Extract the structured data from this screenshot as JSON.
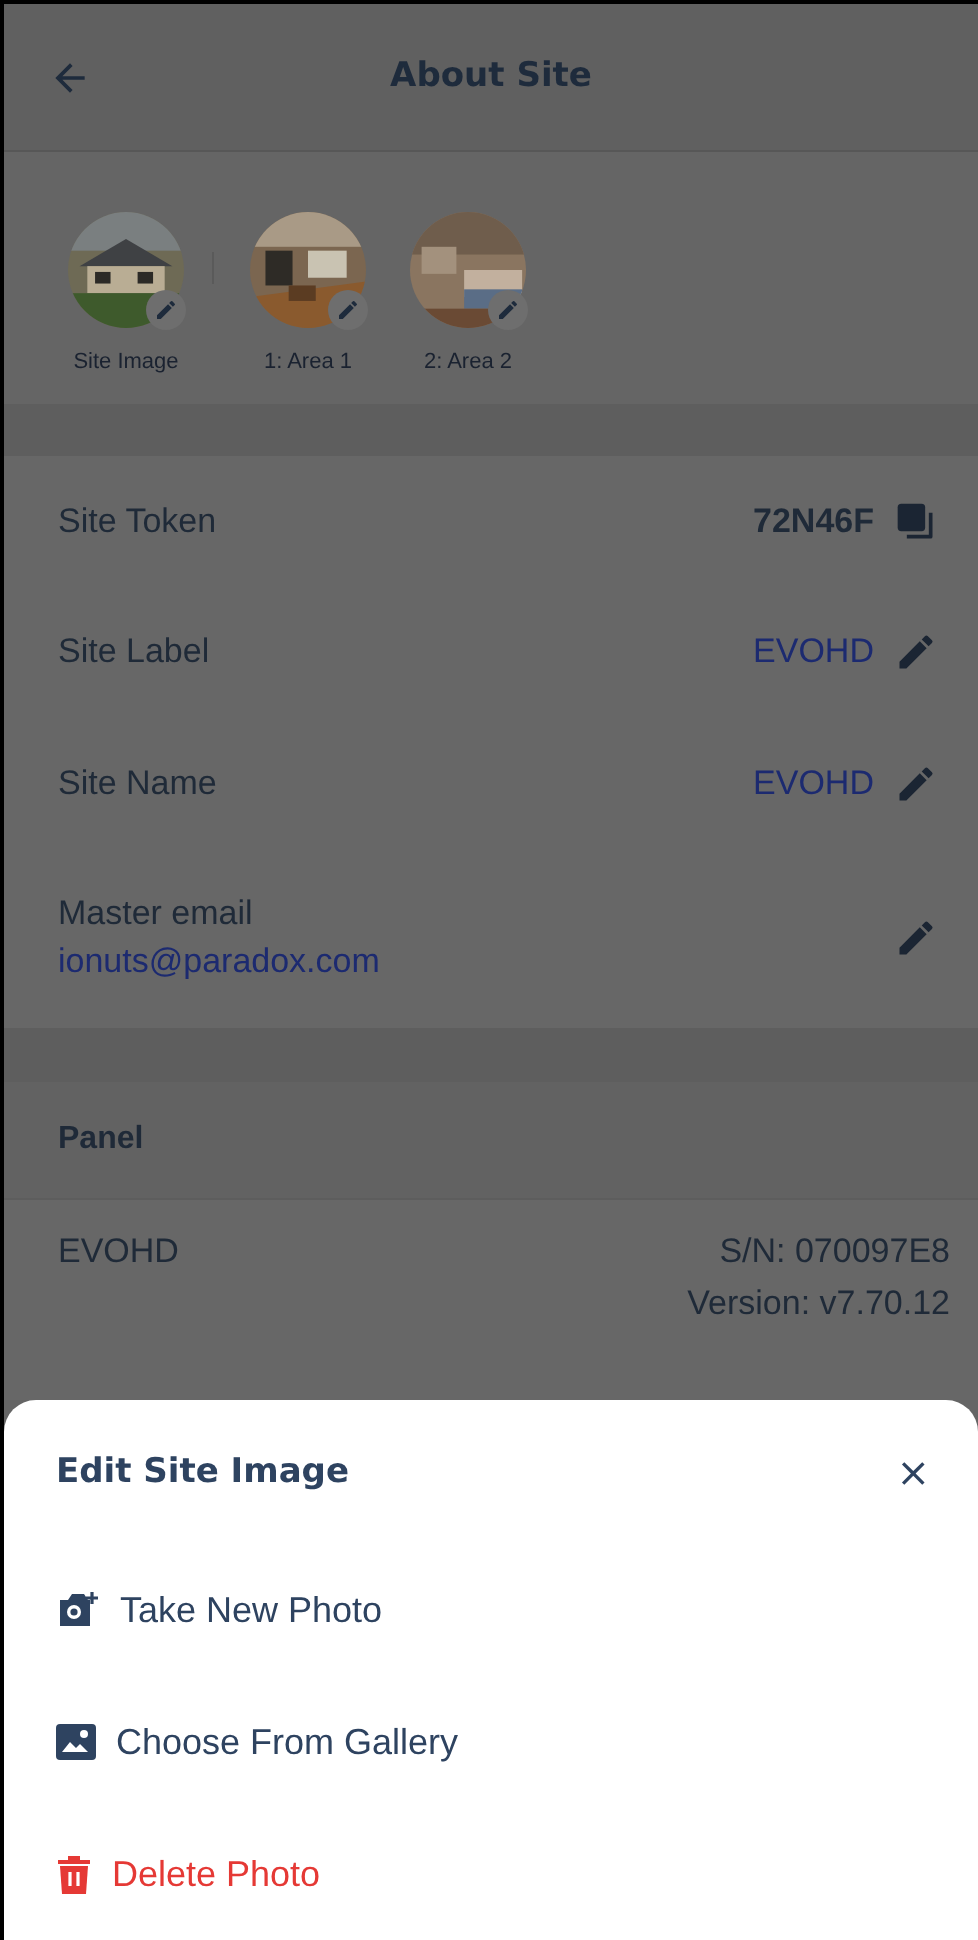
{
  "header": {
    "title": "About Site"
  },
  "images": [
    {
      "label": "Site Image"
    },
    {
      "label": "1: Area 1"
    },
    {
      "label": "2: Area 2"
    }
  ],
  "site_rows": [
    {
      "kind": "copy",
      "label": "Site Token",
      "value": "72N46F"
    },
    {
      "kind": "edit",
      "label": "Site Label",
      "value": "EVOHD"
    },
    {
      "kind": "edit",
      "label": "Site Name",
      "value": "EVOHD"
    },
    {
      "kind": "stacked",
      "label": "Master email",
      "value": "ionuts@paradox.com"
    }
  ],
  "panel": {
    "heading": "Panel",
    "name": "EVOHD",
    "serial": "S/N: 070097E8",
    "version": "Version: v7.70.12"
  },
  "sheet": {
    "title": "Edit Site Image",
    "close": "×",
    "actions": [
      {
        "kind": "camera",
        "label": "Take New Photo"
      },
      {
        "kind": "gallery",
        "label": "Choose From Gallery"
      },
      {
        "kind": "delete",
        "label": "Delete Photo"
      }
    ]
  }
}
